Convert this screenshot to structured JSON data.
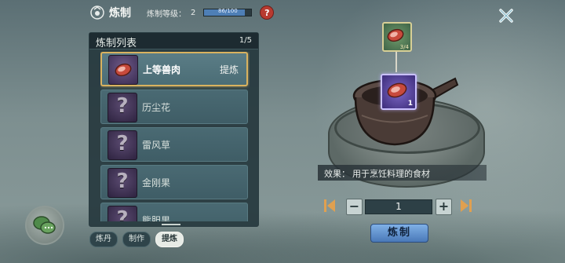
{
  "header": {
    "title": "炼制",
    "level_label": "炼制等级：",
    "level_value": "2",
    "exp_text": "86/100",
    "exp_fraction": 0.86,
    "help_label": "?"
  },
  "list": {
    "title": "炼制列表",
    "page": "1/5",
    "items": [
      {
        "name": "上等兽肉",
        "tag": "提炼",
        "icon": "meat-icon",
        "selected": true
      },
      {
        "name": "历尘花",
        "icon": "unknown-icon"
      },
      {
        "name": "雷风草",
        "icon": "unknown-icon"
      },
      {
        "name": "金刚果",
        "icon": "unknown-icon"
      },
      {
        "name": "熊胆果",
        "icon": "unknown-icon"
      }
    ]
  },
  "tabs": [
    {
      "label": "炼丹"
    },
    {
      "label": "制作"
    },
    {
      "label": "提炼",
      "active": true
    }
  ],
  "slots": {
    "material_count": "3/4",
    "result_count": "1"
  },
  "effect": {
    "label": "效果：",
    "text": "用于烹饪料理的食材"
  },
  "quantity": {
    "minus": "−",
    "value": "1",
    "plus": "+"
  },
  "craft_button": "炼制",
  "colors": {
    "accent_blue": "#4a79b8",
    "selected_border": "#d9b25f",
    "help_red": "#b83a30"
  }
}
